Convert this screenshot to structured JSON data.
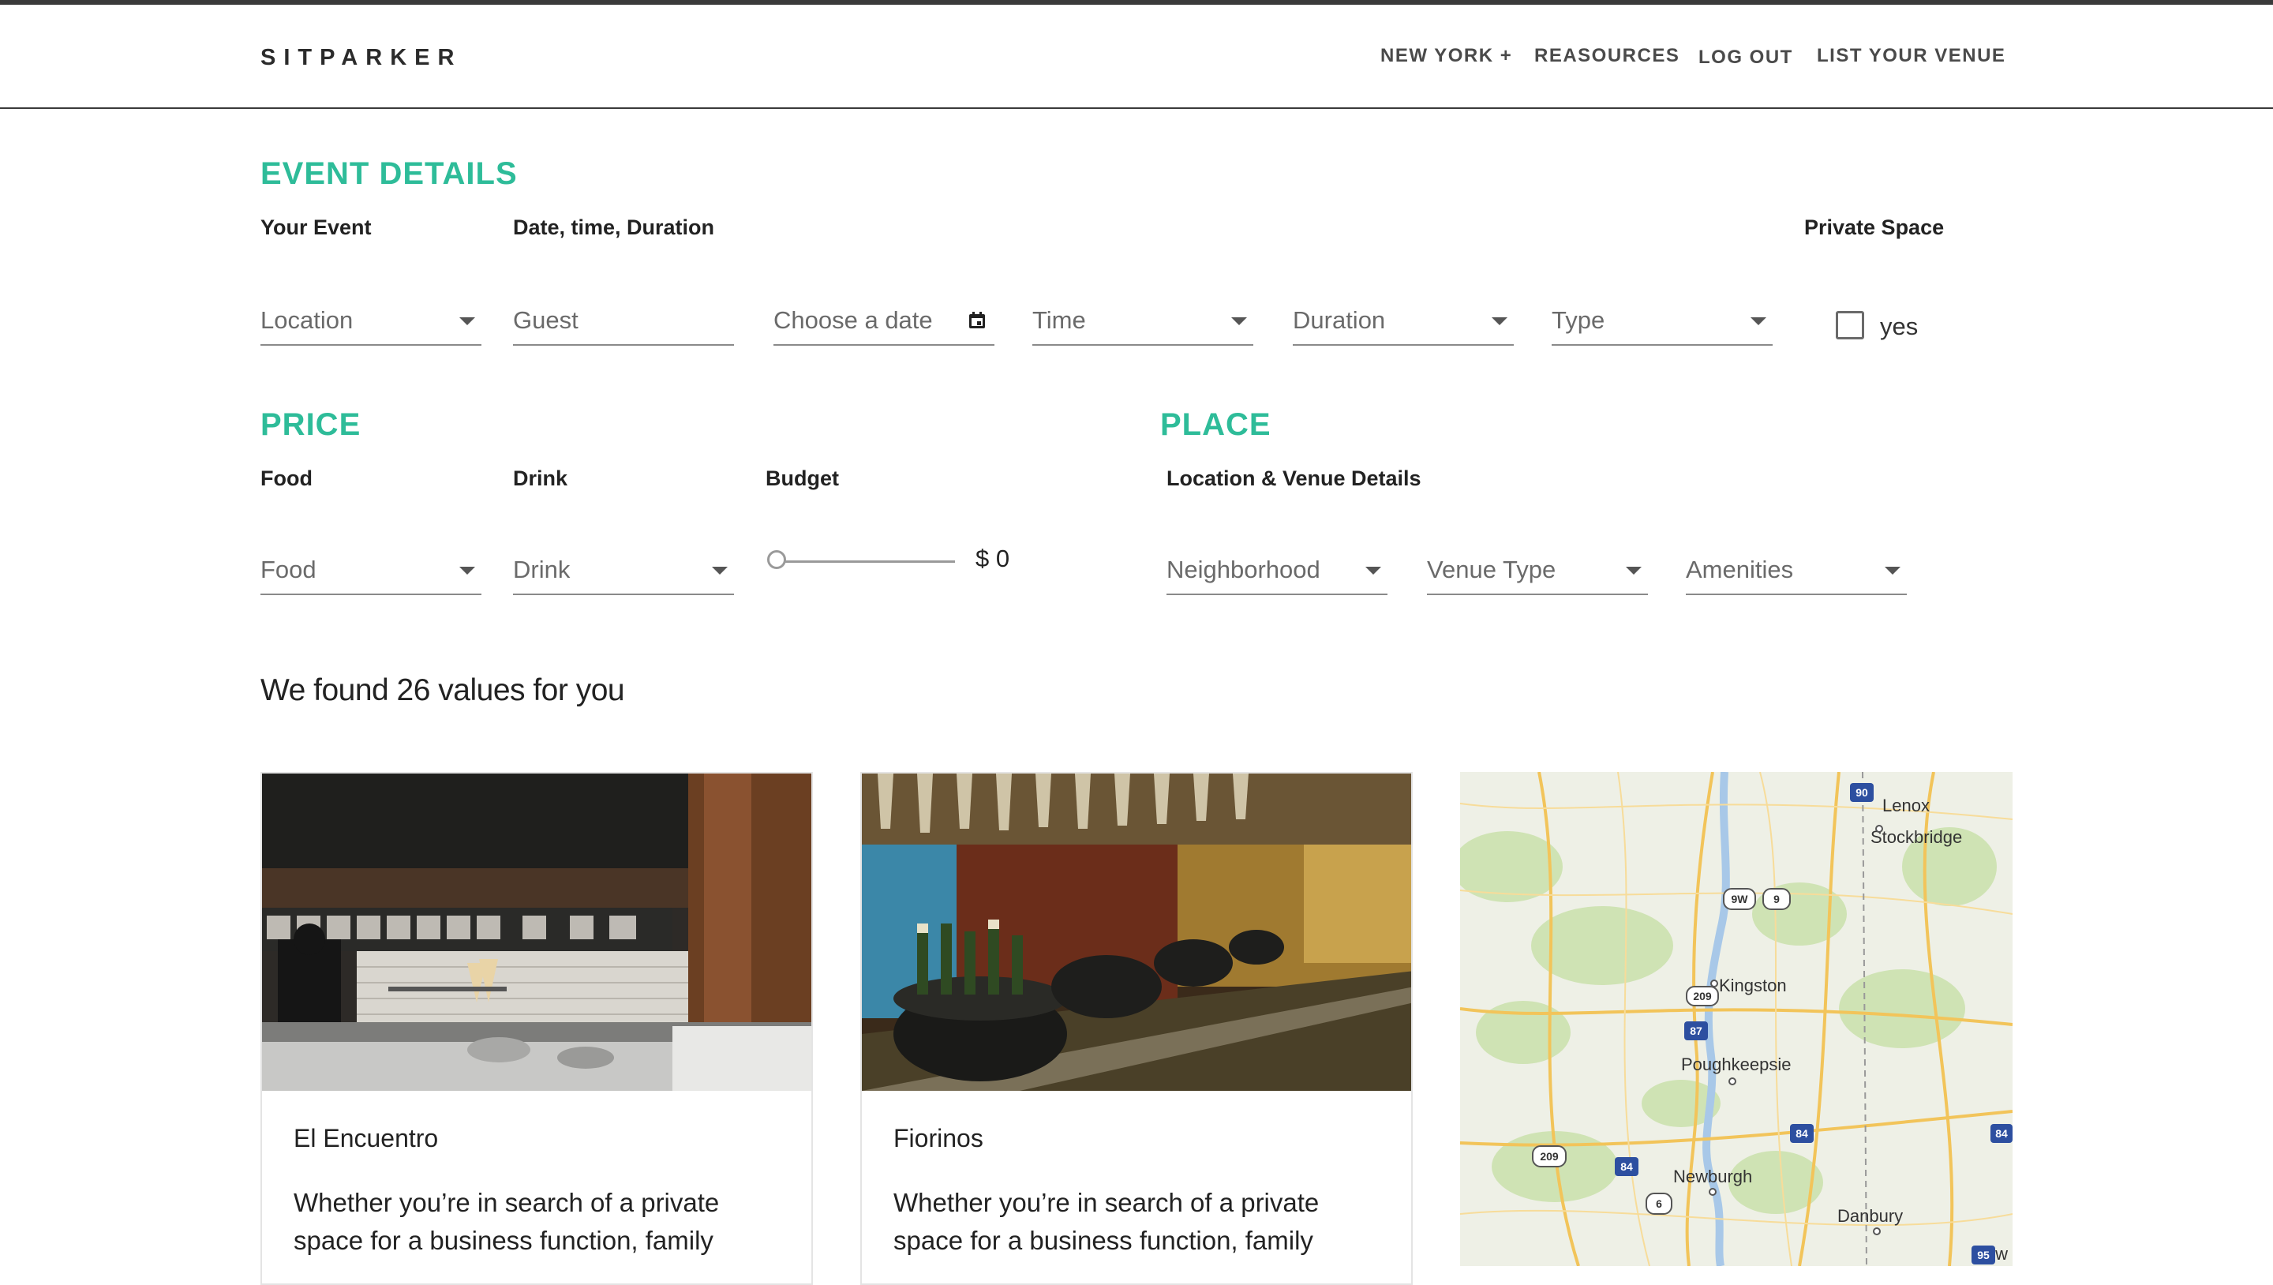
{
  "header": {
    "logo": "SITPARKER",
    "nav": [
      "NEW YORK +",
      "REASOURCES",
      "LOG OUT",
      "LIST YOUR VENUE"
    ]
  },
  "event_details": {
    "title": "EVENT DETAILS",
    "labels": {
      "your_event": "Your Event",
      "date_time": "Date, time, Duration",
      "private_space": "Private Space"
    },
    "fields": {
      "location": "Location",
      "guest": "Guest",
      "date": "Choose a date",
      "time": "Time",
      "duration": "Duration",
      "type": "Type"
    },
    "private_checkbox_label": "yes"
  },
  "price": {
    "title": "PRICE",
    "labels": {
      "food": "Food",
      "drink": "Drink",
      "budget": "Budget"
    },
    "fields": {
      "food": "Food",
      "drink": "Drink"
    },
    "budget_value": "$ 0",
    "budget_fraction": 0
  },
  "place": {
    "title": "PLACE",
    "label": "Location & Venue Details",
    "fields": {
      "neighborhood": "Neighborhood",
      "venue_type": "Venue Type",
      "amenities": "Amenities"
    }
  },
  "results": {
    "heading": "We found 26 values for you",
    "cards": [
      {
        "name": "El Encuentro",
        "description": "Whether you’re in search of a private space for a business function, family"
      },
      {
        "name": "Fiorinos",
        "description": "Whether you’re in search of a private space for a business function, family"
      }
    ]
  },
  "map": {
    "labels": [
      "Lenox",
      "Stockbridge",
      "Kingston",
      "Poughkeepsie",
      "Newburgh",
      "Danbury",
      "New"
    ],
    "shields": [
      "90",
      "9W",
      "9",
      "209",
      "87",
      "84",
      "84",
      "209",
      "84",
      "6",
      "95"
    ]
  },
  "colors": {
    "accent": "#2ebc99",
    "header_border": "#3a3a3a"
  }
}
